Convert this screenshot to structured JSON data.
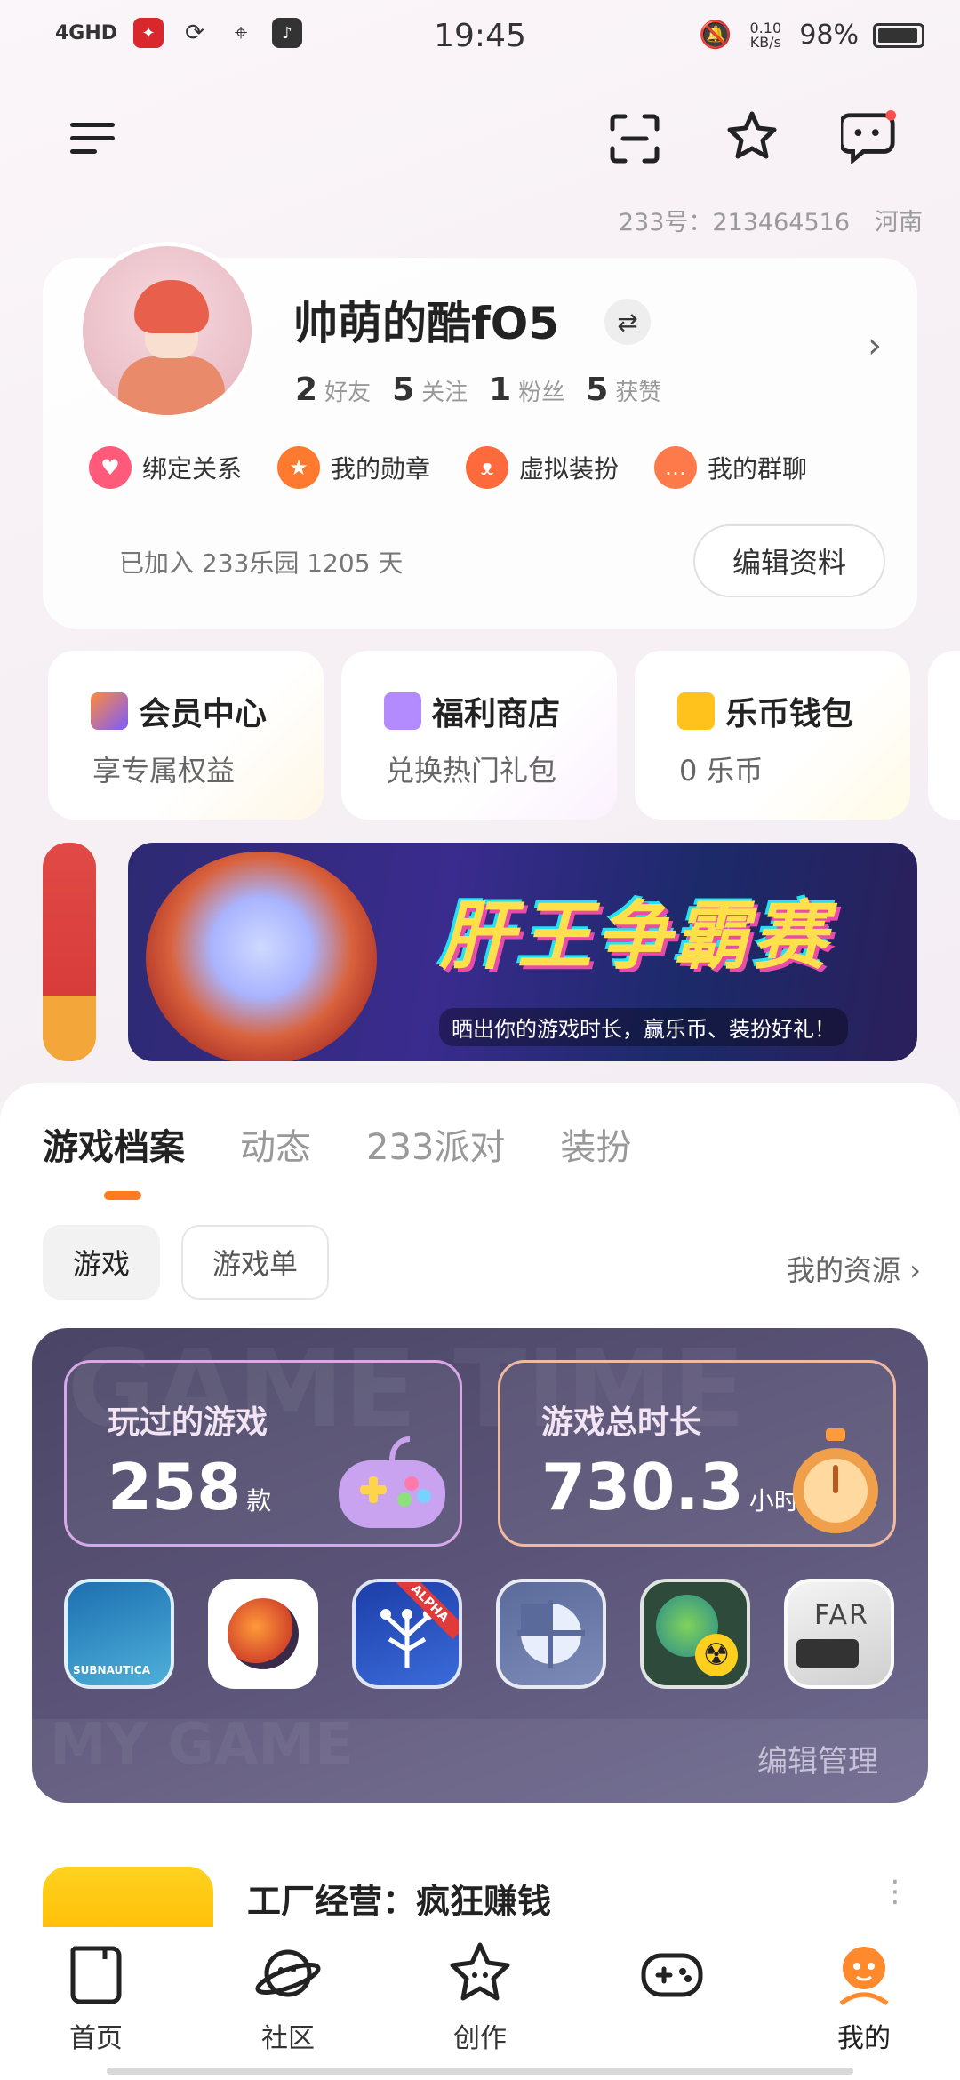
{
  "status_bar": {
    "network": "4GHD",
    "time": "19:45",
    "net_speed": "0.10 KB/s",
    "battery": "98%"
  },
  "header": {
    "menu_icon": "menu-icon",
    "scan_icon": "scan-icon",
    "star_icon": "star-icon",
    "message_icon": "message-icon",
    "id_label": "233号：213464516",
    "region": "河南"
  },
  "profile": {
    "username": "帅萌的酷fO5",
    "stats": [
      {
        "num": "2",
        "label": "好友"
      },
      {
        "num": "5",
        "label": "关注"
      },
      {
        "num": "1",
        "label": "粉丝"
      },
      {
        "num": "5",
        "label": "获赞"
      }
    ],
    "quick_links": [
      {
        "label": "绑定关系",
        "color": "#ff5a7a"
      },
      {
        "label": "我的勋章",
        "color": "#ff7a2e"
      },
      {
        "label": "虚拟装扮",
        "color": "#ff6a3d"
      },
      {
        "label": "我的群聊",
        "color": "#ff7a4a"
      }
    ],
    "joined": "已加入 233乐园 1205 天",
    "edit_button": "编辑资料"
  },
  "features": [
    {
      "title": "会员中心",
      "subtitle": "享专属权益",
      "icon_color": "#ff8a3d"
    },
    {
      "title": "福利商店",
      "subtitle": "兑换热门礼包",
      "icon_color": "#b48bff"
    },
    {
      "title": "乐币钱包",
      "subtitle": "0 乐币",
      "icon_color": "#ffc21d"
    }
  ],
  "banner": {
    "title": "肝王争霸赛",
    "subtitle": "晒出你的游戏时长，赢乐币、装扮好礼！"
  },
  "tabs": [
    "游戏档案",
    "动态",
    "233派对",
    "装扮"
  ],
  "chips": {
    "active": "游戏",
    "inactive": "游戏单"
  },
  "my_resources": "我的资源 ›",
  "game_stats": {
    "played_caption": "玩过的游戏",
    "played_value": "258",
    "played_unit": "款",
    "time_caption": "游戏总时长",
    "time_value": "730.3",
    "time_unit": "小时",
    "manage": "编辑管理",
    "watermark_top": "GAME TIME",
    "watermark_bottom": "MY GAME"
  },
  "games": [
    {
      "name": "SUBNAUTICA 深海迷航",
      "colors": [
        "#1c6fb0",
        "#4fb0d9"
      ]
    },
    {
      "name": "Dome Keeper",
      "colors": [
        "#ffffff",
        "#e34a2c"
      ]
    },
    {
      "name": "ALPHA",
      "colors": [
        "#1c3ea8",
        "#3b6bd9"
      ]
    },
    {
      "name": "Tile",
      "colors": [
        "#5a6a9a",
        "#7d8bb8"
      ]
    },
    {
      "name": "Nuclear",
      "colors": [
        "#2d4a3a",
        "#7fd35a"
      ]
    },
    {
      "name": "FAR",
      "colors": [
        "#f2f2f2",
        "#bfbfbf"
      ]
    }
  ],
  "game_row": {
    "title": "工厂经营：疯狂赚钱",
    "more": "⋮"
  },
  "nav": [
    {
      "label": "首页",
      "icon": "home-icon"
    },
    {
      "label": "社区",
      "icon": "planet-icon"
    },
    {
      "label": "创作",
      "icon": "star-icon"
    },
    {
      "label": "",
      "icon": "gamepad-icon"
    },
    {
      "label": "我的",
      "icon": "mine-icon"
    }
  ]
}
